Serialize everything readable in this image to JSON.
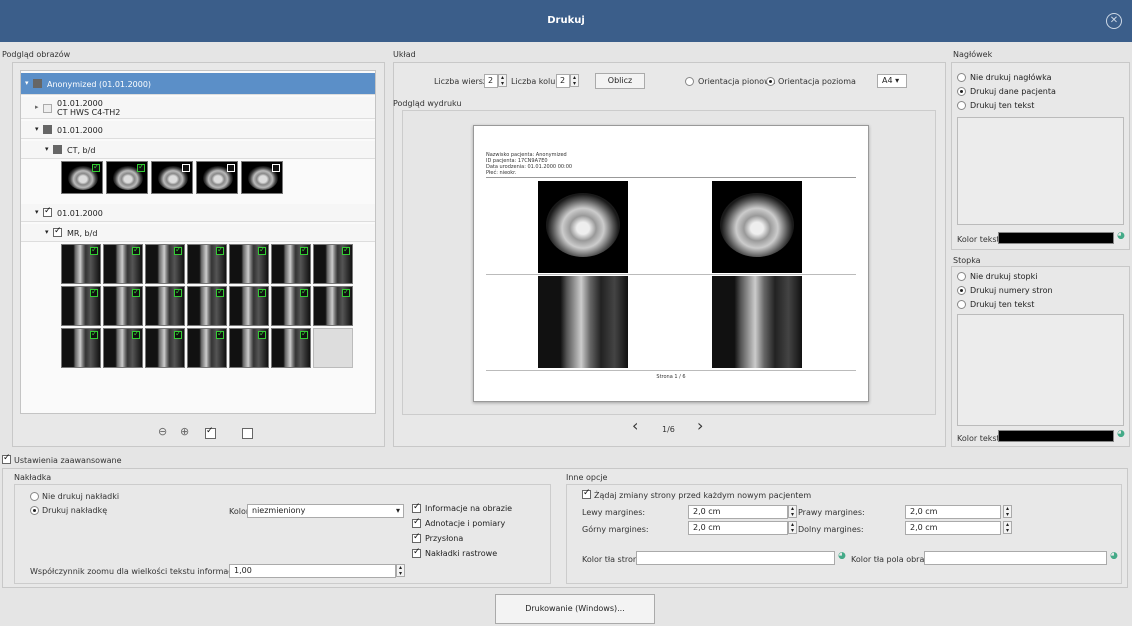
{
  "window": {
    "title": "Drukuj",
    "close_icon": "close-circle-icon"
  },
  "preview_images": {
    "heading": "Podgląd obrazów",
    "tree": {
      "root": "Anonymized (01.01.2000)",
      "study1_date": "01.01.2000",
      "study1_desc": "CT HWS C4-TH2",
      "study2": "01.01.2000",
      "series_ct": "CT, b/d",
      "study3": "01.01.2000",
      "series_mr": "MR, b/d"
    },
    "ct_thumbs_checked": [
      true,
      true,
      false,
      false,
      false
    ],
    "mr_thumbs_checked": [
      true,
      true,
      true,
      true,
      true,
      true,
      true,
      true,
      true,
      true,
      true,
      true,
      true,
      true,
      true,
      true,
      true,
      true,
      true,
      true
    ]
  },
  "layout": {
    "heading": "Układ",
    "rows_label": "Liczba wierszy:",
    "rows_value": "2",
    "cols_label": "Liczba kolumn:",
    "cols_value": "2",
    "compute_button": "Oblicz",
    "portrait_label": "Orientacja pionowa",
    "landscape_label": "Orientacja pozioma",
    "paper_size": "A4",
    "print_preview_heading": "Podgląd wydruku",
    "page_indicator": "1/6"
  },
  "page_preview": {
    "header_lines": [
      "Nazwisko pacjenta: Anonymized",
      "ID pacjenta: 17CN9A7E0",
      "Data urodzenia: 01.01.2000 00:00",
      "Płeć: nieokr."
    ],
    "footer": "Strona 1 / 6"
  },
  "header_section": {
    "heading": "Nagłówek",
    "options": [
      "Nie drukuj nagłówka",
      "Drukuj dane pacjenta",
      "Drukuj ten tekst"
    ],
    "selected": 1,
    "text_color_label": "Kolor tekstu:",
    "text_color": "#000000"
  },
  "footer_section": {
    "heading": "Stopka",
    "options": [
      "Nie drukuj stopki",
      "Drukuj numery stron",
      "Drukuj ten tekst"
    ],
    "selected": 1,
    "text_color_label": "Kolor tekstu:",
    "text_color": "#000000"
  },
  "advanced": {
    "toggle_label": "Ustawienia zaawansowane",
    "overlay": {
      "heading": "Nakładka",
      "no_overlay": "Nie drukuj nakładki",
      "print_overlay": "Drukuj nakładkę",
      "color_label": "Kolor:",
      "color_value": "niezmieniony",
      "checks": [
        "Informacje na obrazie",
        "Adnotacje i pomiary",
        "Przysłona",
        "Nakładki rastrowe"
      ],
      "zoom_label": "Współczynnik zoomu dla wielkości tekstu informacji na obrazie:",
      "zoom_value": "1,00"
    },
    "other": {
      "heading": "Inne opcje",
      "page_change_label": "Żądaj zmiany strony przed każdym nowym pacjentem",
      "left_margin_label": "Lewy margines:",
      "left_margin": "2,0 cm",
      "right_margin_label": "Prawy margines:",
      "right_margin": "2,0 cm",
      "top_margin_label": "Górny margines:",
      "top_margin": "2,0 cm",
      "bottom_margin_label": "Dolny margines:",
      "bottom_margin": "2,0 cm",
      "page_bg_label": "Kolor tła strony:",
      "image_bg_label": "Kolor tła pola obrazu:"
    }
  },
  "print_button": "Drukowanie (Windows)...",
  "colors": {
    "titlebar": "#3b5e8a",
    "selection": "#5b8fc8",
    "check_green": "#33cc33"
  }
}
